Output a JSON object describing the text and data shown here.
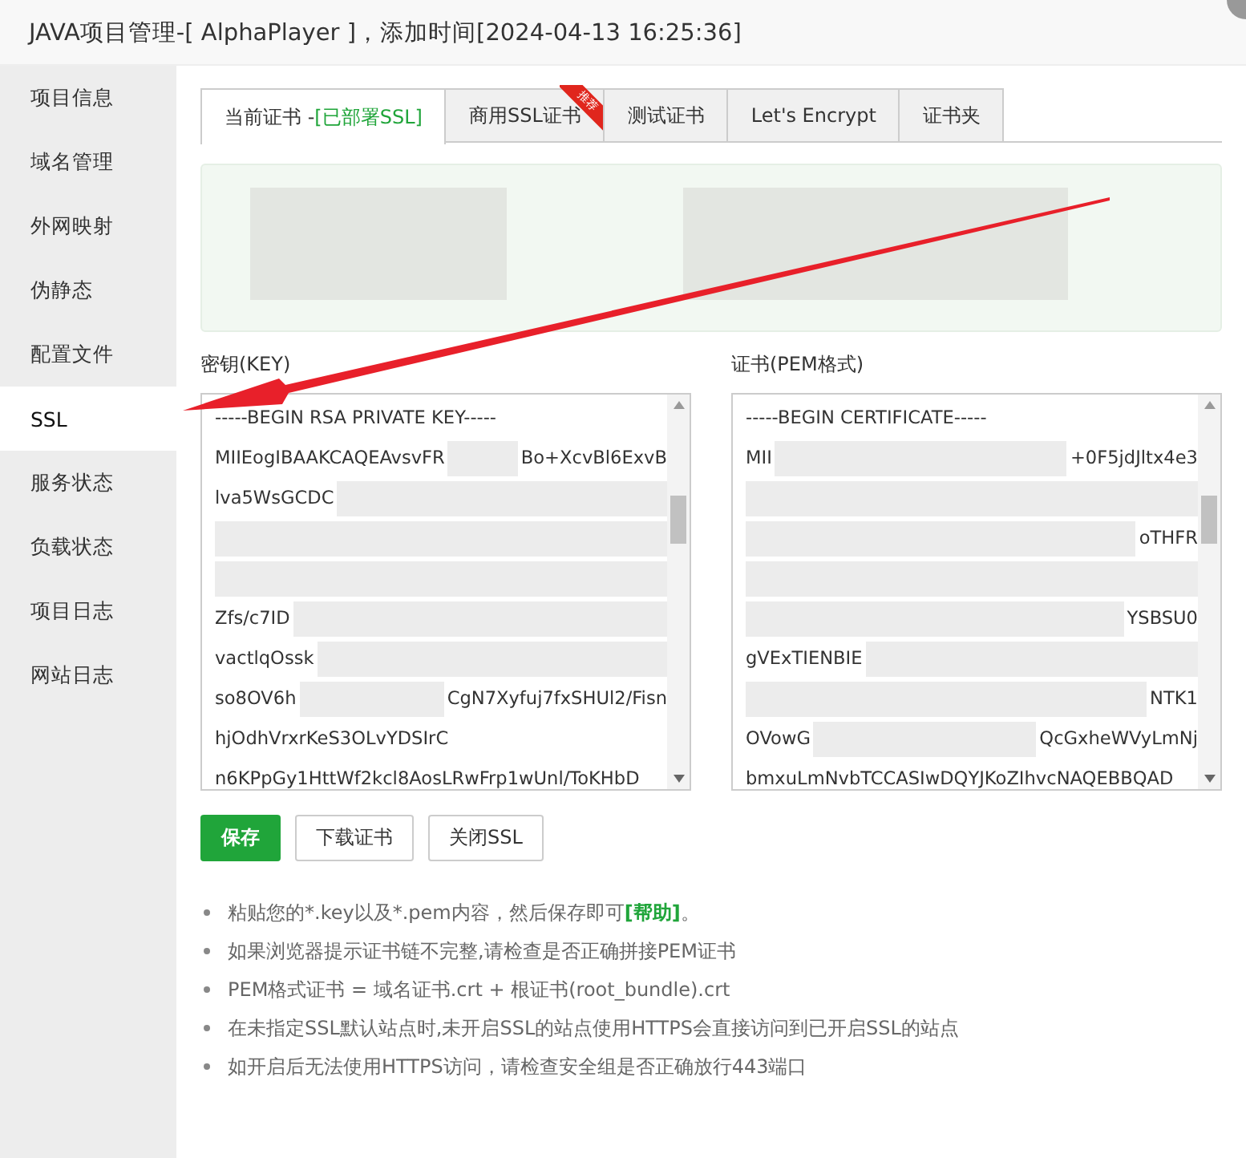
{
  "window": {
    "title": "JAVA项目管理-[ AlphaPlayer ]，添加时间[2024-04-13 16:25:36]"
  },
  "sidebar": {
    "items": [
      {
        "label": "项目信息",
        "selected": false
      },
      {
        "label": "域名管理",
        "selected": false
      },
      {
        "label": "外网映射",
        "selected": false
      },
      {
        "label": "伪静态",
        "selected": false
      },
      {
        "label": "配置文件",
        "selected": false
      },
      {
        "label": "SSL",
        "selected": true
      },
      {
        "label": "服务状态",
        "selected": false
      },
      {
        "label": "负载状态",
        "selected": false
      },
      {
        "label": "项目日志",
        "selected": false
      },
      {
        "label": "网站日志",
        "selected": false
      }
    ]
  },
  "tabs": [
    {
      "label": "当前证书 - ",
      "status": "[已部署SSL]",
      "selected": true
    },
    {
      "label": "商用SSL证书",
      "badge": "推荐",
      "selected": false
    },
    {
      "label": "测试证书",
      "selected": false
    },
    {
      "label": "Let's Encrypt",
      "selected": false
    },
    {
      "label": "证书夹",
      "selected": false
    }
  ],
  "key_field": {
    "label": "密钥(KEY)",
    "lines": [
      {
        "left": "-----BEGIN RSA PRIVATE KEY-----"
      },
      {
        "left": "MIIEogIBAAKCAQEAvsvFR",
        "right": "Bo+XcvBl6ExvB",
        "redacted": true
      },
      {
        "left": "lva5WsGCDC",
        "redacted": true
      },
      {
        "redacted": true
      },
      {
        "redacted": true
      },
      {
        "left": "Zfs/c7ID",
        "redacted": true
      },
      {
        "left": "vactlqOssk",
        "redacted": true
      },
      {
        "left": "so8OV6h",
        "right": "CgN7Xyfuj7fxSHUl2/Fisn",
        "redacted": true
      },
      {
        "left": "hjOdhVrxrKeS3OLvYDSIrC"
      },
      {
        "left": "n6KPpGy1HttWf2kcl8AosLRwFrp1wUnl/ToKHbD"
      }
    ]
  },
  "cert_field": {
    "label": "证书(PEM格式)",
    "lines": [
      {
        "left": "-----BEGIN CERTIFICATE-----"
      },
      {
        "left": "MII",
        "right": "+0F5jdJltx4e3",
        "redacted": true
      },
      {
        "redacted": true
      },
      {
        "right": "oTHFR",
        "redacted": true
      },
      {
        "redacted": true
      },
      {
        "right": "YSBSU0",
        "redacted": true
      },
      {
        "left": "gVExTIENBIE",
        "redacted": true
      },
      {
        "right": "NTK1",
        "redacted": true
      },
      {
        "left": "OVowG",
        "right": "QcGxheWVyLmNj",
        "redacted": true
      },
      {
        "left": "bmxuLmNvbTCCASIwDQYJKoZIhvcNAQEBBQAD"
      }
    ]
  },
  "buttons": [
    {
      "label": "保存",
      "kind": "primary"
    },
    {
      "label": "下载证书",
      "kind": "default"
    },
    {
      "label": "关闭SSL",
      "kind": "default"
    }
  ],
  "notes": [
    {
      "text": "粘贴您的*.key以及*.pem内容，然后保存即可",
      "link": "[帮助]",
      "suffix": "。"
    },
    {
      "text": "如果浏览器提示证书链不完整,请检查是否正确拼接PEM证书"
    },
    {
      "text": "PEM格式证书 = 域名证书.crt + 根证书(root_bundle).crt"
    },
    {
      "text": "在未指定SSL默认站点时,未开启SSL的站点使用HTTPS会直接访问到已开启SSL的站点"
    },
    {
      "text": "如开启后无法使用HTTPS访问，请检查安全组是否正确放行443端口"
    }
  ]
}
